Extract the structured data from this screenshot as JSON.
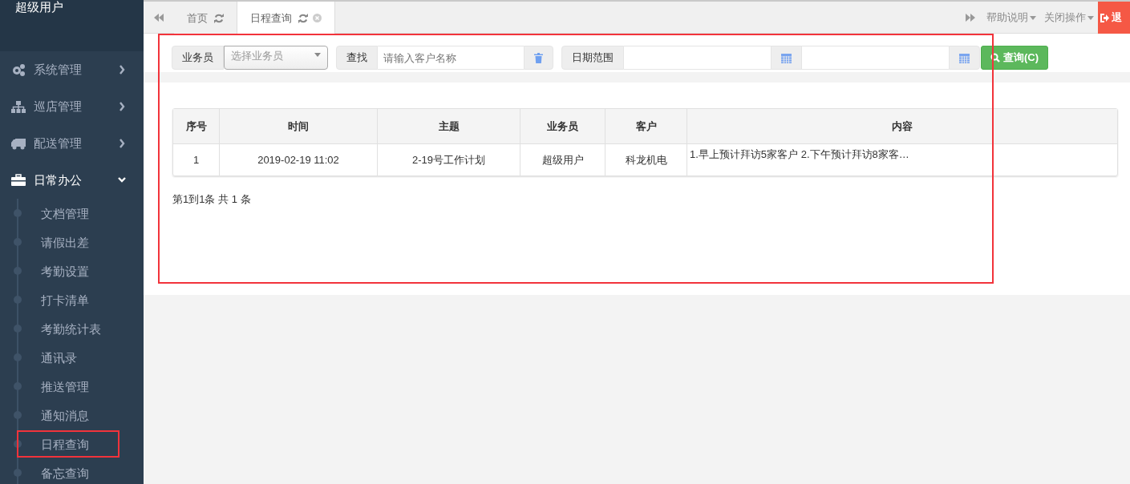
{
  "sidebar": {
    "user": "超级用户",
    "items": [
      {
        "label": "系统管理",
        "kind": "gears",
        "expanded": false
      },
      {
        "label": "巡店管理",
        "kind": "sitemap",
        "expanded": false
      },
      {
        "label": "配送管理",
        "kind": "truck",
        "expanded": false
      },
      {
        "label": "日常办公",
        "kind": "briefcase",
        "expanded": true,
        "children": [
          {
            "label": "文档管理",
            "highlighted": false
          },
          {
            "label": "请假出差",
            "highlighted": false
          },
          {
            "label": "考勤设置",
            "highlighted": false
          },
          {
            "label": "打卡清单",
            "highlighted": false
          },
          {
            "label": "考勤统计表",
            "highlighted": false
          },
          {
            "label": "通讯录",
            "highlighted": false
          },
          {
            "label": "推送管理",
            "highlighted": false
          },
          {
            "label": "通知消息",
            "highlighted": false
          },
          {
            "label": "日程查询",
            "highlighted": true
          },
          {
            "label": "备忘查询",
            "highlighted": false
          }
        ]
      }
    ]
  },
  "tabbar": {
    "tabs": [
      {
        "label": "首页",
        "selected": false,
        "closable": false
      },
      {
        "label": "日程查询",
        "selected": true,
        "closable": true
      }
    ],
    "menus": [
      "帮助说明",
      "关闭操作"
    ],
    "logout": "退"
  },
  "filters": {
    "highlighted": true,
    "salesman_label": "业务员",
    "salesman_placeholder": "选择业务员",
    "search_label": "查找",
    "search_placeholder": "请输入客户名称",
    "date_label": "日期范围",
    "query_button": "查询(C)"
  },
  "table": {
    "columns": [
      "序号",
      "时间",
      "主题",
      "业务员",
      "客户",
      "内容"
    ],
    "rows": [
      [
        "1",
        "2019-02-19 11:02",
        "2-19号工作计划",
        "超级用户",
        "科龙机电",
        "1.早上预计拜访5家客户 2.下午预计拜访8家客…"
      ]
    ]
  },
  "pager": "第1到1条 共 1 条"
}
